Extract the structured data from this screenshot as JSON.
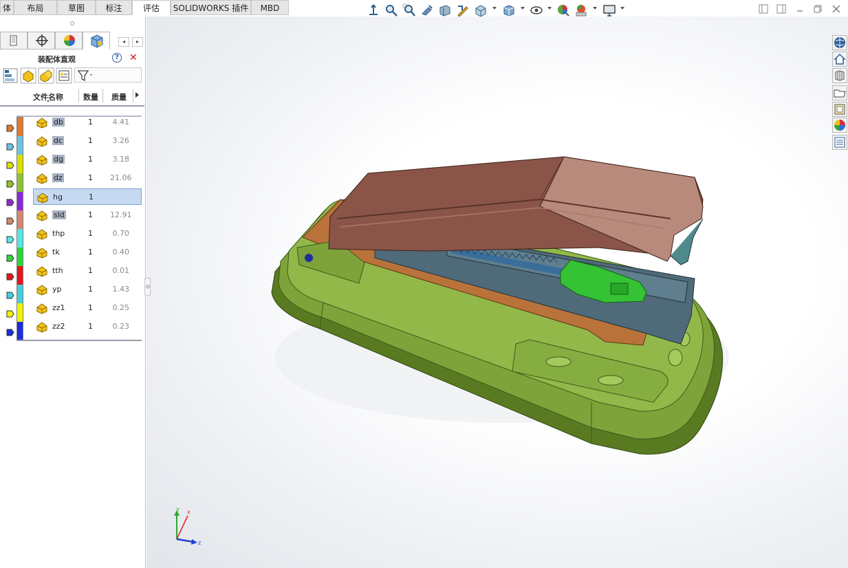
{
  "command_tabs": [
    "体",
    "布局",
    "草图",
    "标注",
    "评估",
    "SOLIDWORKS 插件",
    "MBD"
  ],
  "active_tab": "评估",
  "hud_icons": [
    "view-orientation-icon",
    "zoom-to-fit-icon",
    "zoom-to-area-icon",
    "previous-view-icon",
    "section-view-icon",
    "dynamic-annotation-icon",
    "view-orientation-cube-icon",
    "display-style-icon",
    "hide-show-items-icon",
    "edit-appearance-icon",
    "apply-scene-icon",
    "view-settings-icon"
  ],
  "panel": {
    "title": "装配体直观",
    "help_label": "?",
    "close_label": "✕",
    "columns": {
      "name": "文件名称",
      "qty": "数量",
      "mass": "质量"
    },
    "rows": [
      {
        "name": "db",
        "qty": "1",
        "mass": "4.41",
        "highlight": true,
        "color": "#e07a2e"
      },
      {
        "name": "dc",
        "qty": "1",
        "mass": "3.26",
        "highlight": true,
        "color": "#6cc3e6"
      },
      {
        "name": "dg",
        "qty": "1",
        "mass": "3.18",
        "highlight": true,
        "color": "#d8e000"
      },
      {
        "name": "dz",
        "qty": "1",
        "mass": "21.06",
        "highlight": true,
        "color": "#8ec22e"
      },
      {
        "name": "hg",
        "qty": "1",
        "mass": "",
        "highlight": false,
        "color": "#8a2ad6",
        "selected": true
      },
      {
        "name": "sld",
        "qty": "1",
        "mass": "12.91",
        "highlight": true,
        "color": "#d4866e"
      },
      {
        "name": "thp",
        "qty": "1",
        "mass": "0.70",
        "highlight": false,
        "color": "#58e6e6"
      },
      {
        "name": "tk",
        "qty": "1",
        "mass": "0.40",
        "highlight": false,
        "color": "#2fd43a"
      },
      {
        "name": "tth",
        "qty": "1",
        "mass": "0.01",
        "highlight": false,
        "color": "#e8141c"
      },
      {
        "name": "yp",
        "qty": "1",
        "mass": "1.43",
        "highlight": false,
        "color": "#46cde0"
      },
      {
        "name": "zz1",
        "qty": "1",
        "mass": "0.25",
        "highlight": false,
        "color": "#f2f200"
      },
      {
        "name": "zz2",
        "qty": "1",
        "mass": "0.23",
        "highlight": false,
        "color": "#1a2fe0"
      }
    ]
  },
  "triad": {
    "x": "x",
    "y": "y",
    "z": "z"
  },
  "task_pane_icons": [
    "solidworks-resources-icon",
    "home-icon",
    "design-library-icon",
    "file-explorer-icon",
    "view-palette-icon",
    "appearances-icon",
    "custom-properties-icon"
  ],
  "colors": {
    "base_green": "#7ea33a",
    "handle_brown": "#8a5548",
    "rail_slate": "#4f6a78",
    "clip_green": "#35c235"
  }
}
